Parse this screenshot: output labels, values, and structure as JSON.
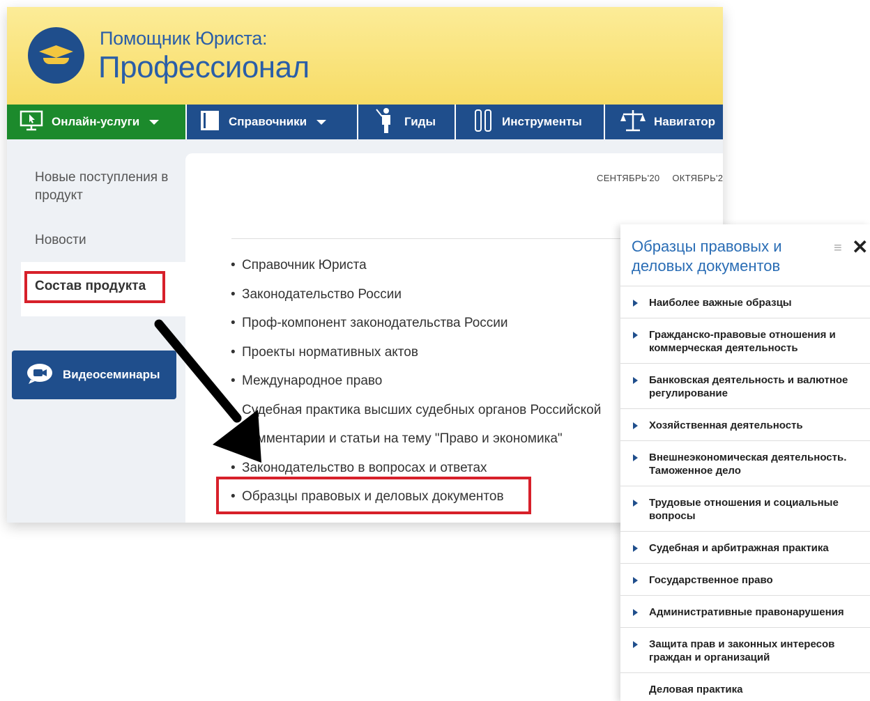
{
  "header": {
    "subtitle": "Помощник Юриста:",
    "title": "Профессионал"
  },
  "nav": [
    {
      "label": "Онлайн-услуги",
      "icon": "screen-cursor-icon"
    },
    {
      "label": "Справочники",
      "icon": "book-icon"
    },
    {
      "label": "Гиды",
      "icon": "guide-person-icon"
    },
    {
      "label": "Инструменты",
      "icon": "tools-icon"
    },
    {
      "label": "Навигатор",
      "icon": "scales-icon"
    }
  ],
  "sidebar": {
    "new_items": "Новые поступления в продукт",
    "news": "Новости",
    "active": "Состав продукта",
    "video": "Видеосеминары"
  },
  "content": {
    "months": [
      "СЕНТЯБРЬ'20",
      "ОКТЯБРЬ'2"
    ],
    "items": [
      "Справочник Юриста",
      "Законодательство России",
      "Проф-компонент законодательства России",
      "Проекты нормативных актов",
      "Международное право",
      "Судебная практика высших судебных органов Российской",
      "Комментарии и статьи на тему \"Право и экономика\"",
      "Законодательство в вопросах и ответах",
      "Образцы правовых и деловых документов"
    ]
  },
  "panel": {
    "title": "Образцы правовых и деловых документов",
    "items": [
      "Наиболее важные образцы",
      "Гражданско-правовые отношения и коммерческая деятельность",
      "Банковская деятельность и валютное регулирование",
      "Хозяйственная деятельность",
      "Внешнеэкономическая деятельность. Таможенное дело",
      "Трудовые отношения и социальные вопросы",
      "Судебная и арбитражная практика",
      "Государственное право",
      "Административные правонарушения",
      "Защита прав и законных интересов граждан и организаций",
      "Деловая практика"
    ]
  },
  "colors": {
    "brand_blue": "#1f4e8c",
    "nav_green": "#1c8a2c",
    "highlight_red": "#d7202a",
    "header_yellow": "#f7dc66"
  }
}
